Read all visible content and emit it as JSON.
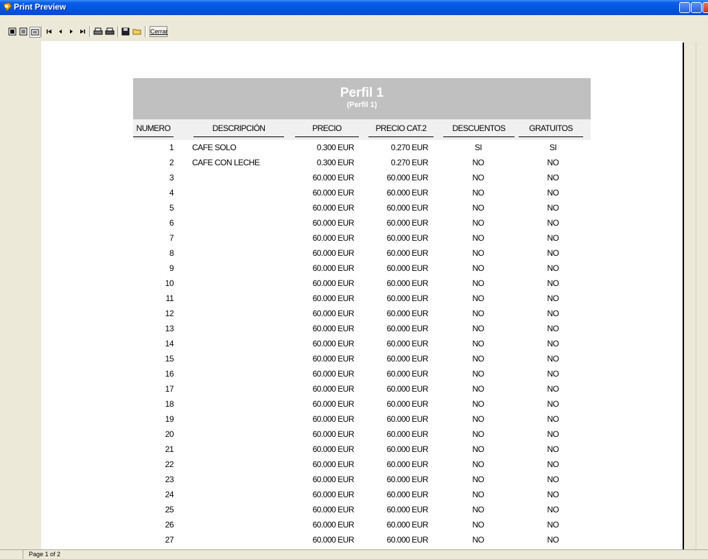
{
  "window": {
    "title": "Print Preview"
  },
  "toolbar": {
    "close_label": "Cerrar"
  },
  "status": {
    "page": "Page 1 of 2"
  },
  "report": {
    "title": "Perfil 1",
    "subtitle": "(Perfil 1)",
    "columns": [
      "NUMERO",
      "DESCRIPCIÓN",
      "PRECIO",
      "PRECIO CAT.2",
      "DESCUENTOS",
      "GRATUITOS"
    ],
    "rows": [
      {
        "num": "1",
        "desc": "CAFE SOLO",
        "precio": "0.300 EUR",
        "cat2": "0.270 EUR",
        "desc2": "SI",
        "grat": "SI"
      },
      {
        "num": "2",
        "desc": "CAFE CON LECHE",
        "precio": "0.300 EUR",
        "cat2": "0.270 EUR",
        "desc2": "NO",
        "grat": "NO"
      },
      {
        "num": "3",
        "desc": "",
        "precio": "60.000 EUR",
        "cat2": "60.000 EUR",
        "desc2": "NO",
        "grat": "NO"
      },
      {
        "num": "4",
        "desc": "",
        "precio": "60.000 EUR",
        "cat2": "60.000 EUR",
        "desc2": "NO",
        "grat": "NO"
      },
      {
        "num": "5",
        "desc": "",
        "precio": "60.000 EUR",
        "cat2": "60.000 EUR",
        "desc2": "NO",
        "grat": "NO"
      },
      {
        "num": "6",
        "desc": "",
        "precio": "60.000 EUR",
        "cat2": "60.000 EUR",
        "desc2": "NO",
        "grat": "NO"
      },
      {
        "num": "7",
        "desc": "",
        "precio": "60.000 EUR",
        "cat2": "60.000 EUR",
        "desc2": "NO",
        "grat": "NO"
      },
      {
        "num": "8",
        "desc": "",
        "precio": "60.000 EUR",
        "cat2": "60.000 EUR",
        "desc2": "NO",
        "grat": "NO"
      },
      {
        "num": "9",
        "desc": "",
        "precio": "60.000 EUR",
        "cat2": "60.000 EUR",
        "desc2": "NO",
        "grat": "NO"
      },
      {
        "num": "10",
        "desc": "",
        "precio": "60.000 EUR",
        "cat2": "60.000 EUR",
        "desc2": "NO",
        "grat": "NO"
      },
      {
        "num": "11",
        "desc": "",
        "precio": "60.000 EUR",
        "cat2": "60.000 EUR",
        "desc2": "NO",
        "grat": "NO"
      },
      {
        "num": "12",
        "desc": "",
        "precio": "60.000 EUR",
        "cat2": "60.000 EUR",
        "desc2": "NO",
        "grat": "NO"
      },
      {
        "num": "13",
        "desc": "",
        "precio": "60.000 EUR",
        "cat2": "60.000 EUR",
        "desc2": "NO",
        "grat": "NO"
      },
      {
        "num": "14",
        "desc": "",
        "precio": "60.000 EUR",
        "cat2": "60.000 EUR",
        "desc2": "NO",
        "grat": "NO"
      },
      {
        "num": "15",
        "desc": "",
        "precio": "60.000 EUR",
        "cat2": "60.000 EUR",
        "desc2": "NO",
        "grat": "NO"
      },
      {
        "num": "16",
        "desc": "",
        "precio": "60.000 EUR",
        "cat2": "60.000 EUR",
        "desc2": "NO",
        "grat": "NO"
      },
      {
        "num": "17",
        "desc": "",
        "precio": "60.000 EUR",
        "cat2": "60.000 EUR",
        "desc2": "NO",
        "grat": "NO"
      },
      {
        "num": "18",
        "desc": "",
        "precio": "60.000 EUR",
        "cat2": "60.000 EUR",
        "desc2": "NO",
        "grat": "NO"
      },
      {
        "num": "19",
        "desc": "",
        "precio": "60.000 EUR",
        "cat2": "60.000 EUR",
        "desc2": "NO",
        "grat": "NO"
      },
      {
        "num": "20",
        "desc": "",
        "precio": "60.000 EUR",
        "cat2": "60.000 EUR",
        "desc2": "NO",
        "grat": "NO"
      },
      {
        "num": "21",
        "desc": "",
        "precio": "60.000 EUR",
        "cat2": "60.000 EUR",
        "desc2": "NO",
        "grat": "NO"
      },
      {
        "num": "22",
        "desc": "",
        "precio": "60.000 EUR",
        "cat2": "60.000 EUR",
        "desc2": "NO",
        "grat": "NO"
      },
      {
        "num": "23",
        "desc": "",
        "precio": "60.000 EUR",
        "cat2": "60.000 EUR",
        "desc2": "NO",
        "grat": "NO"
      },
      {
        "num": "24",
        "desc": "",
        "precio": "60.000 EUR",
        "cat2": "60.000 EUR",
        "desc2": "NO",
        "grat": "NO"
      },
      {
        "num": "25",
        "desc": "",
        "precio": "60.000 EUR",
        "cat2": "60.000 EUR",
        "desc2": "NO",
        "grat": "NO"
      },
      {
        "num": "26",
        "desc": "",
        "precio": "60.000 EUR",
        "cat2": "60.000 EUR",
        "desc2": "NO",
        "grat": "NO"
      },
      {
        "num": "27",
        "desc": "",
        "precio": "60.000 EUR",
        "cat2": "60.000 EUR",
        "desc2": "NO",
        "grat": "NO"
      }
    ]
  }
}
